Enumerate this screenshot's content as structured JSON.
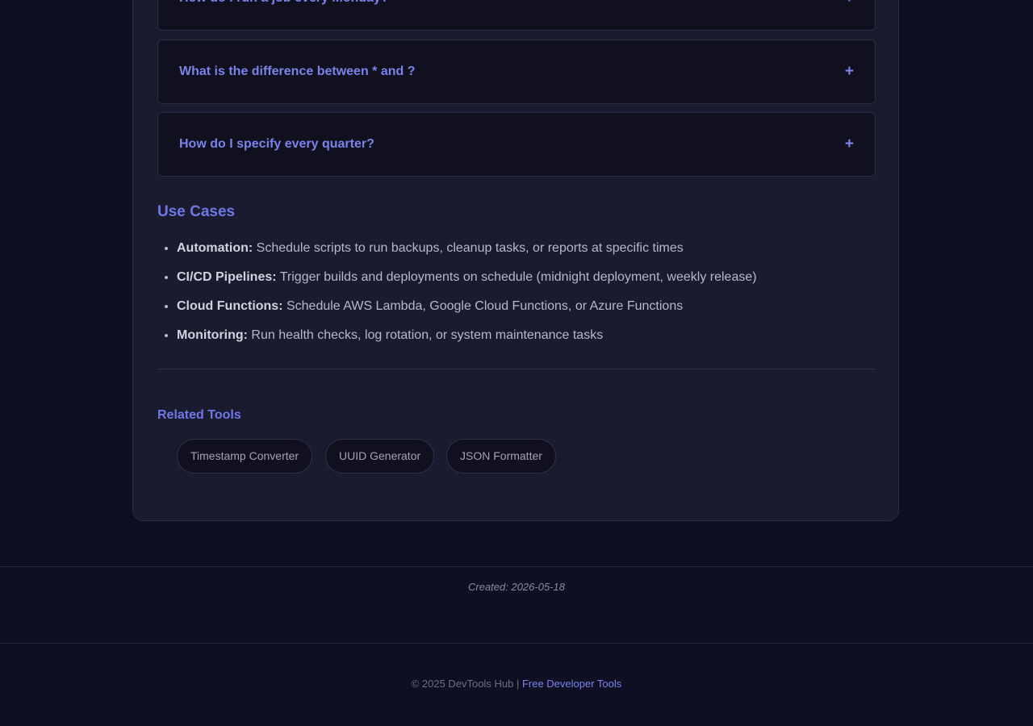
{
  "faq": {
    "items": [
      {
        "question": "How do I run a job every Monday?",
        "toggle": "+"
      },
      {
        "question": "What is the difference between * and ?",
        "toggle": "+"
      },
      {
        "question": "How do I specify every quarter?",
        "toggle": "+"
      }
    ]
  },
  "use_cases": {
    "title": "Use Cases",
    "items": [
      {
        "label": "Automation:",
        "text": " Schedule scripts to run backups, cleanup tasks, or reports at specific times"
      },
      {
        "label": "CI/CD Pipelines:",
        "text": " Trigger builds and deployments on schedule (midnight deployment, weekly release)"
      },
      {
        "label": "Cloud Functions:",
        "text": " Schedule AWS Lambda, Google Cloud Functions, or Azure Functions"
      },
      {
        "label": "Monitoring:",
        "text": " Run health checks, log rotation, or system maintenance tasks"
      }
    ]
  },
  "related_tools": {
    "title": "Related Tools",
    "items": [
      "Timestamp Converter",
      "UUID Generator",
      "JSON Formatter"
    ]
  },
  "meta": {
    "created": "Created: 2026-05-18"
  },
  "footer": {
    "copyright": "© 2025 DevTools Hub | ",
    "link_label": "Free Developer Tools"
  },
  "colors": {
    "background": "#0f0f23",
    "panel": "#1a1b2e",
    "accent": "#7b83ea"
  }
}
